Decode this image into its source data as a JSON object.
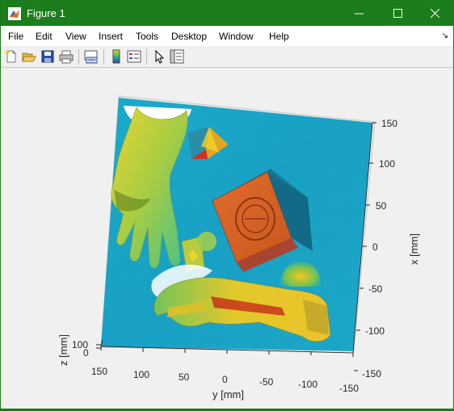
{
  "window": {
    "title": "Figure 1"
  },
  "controls": {
    "minimize": "minimize",
    "maximize": "maximize",
    "close": "close"
  },
  "menu": [
    "File",
    "Edit",
    "View",
    "Insert",
    "Tools",
    "Desktop",
    "Window",
    "Help"
  ],
  "toolbar": [
    "new-figure",
    "open-file",
    "save",
    "print",
    "link-plot",
    "colorbar",
    "legend",
    "edit-plot",
    "property-inspector"
  ],
  "plot": {
    "x_axis_label": "x [mm]",
    "y_axis_label": "y [mm]",
    "z_axis_label": "z [mm]",
    "x_ticks": [
      "150",
      "100",
      "50",
      "0",
      "-50",
      "-100",
      "-150"
    ],
    "y_ticks": [
      "150",
      "100",
      "50",
      "0",
      "-50",
      "-100",
      "-150"
    ],
    "z_ticks": [
      "100",
      "0"
    ],
    "colormap": "parula-like",
    "colors": {
      "background_scan": "#1aa6c8",
      "hand": "#c8d23a",
      "stamp": "#d8642a",
      "pyramid": "#e6a020"
    }
  }
}
